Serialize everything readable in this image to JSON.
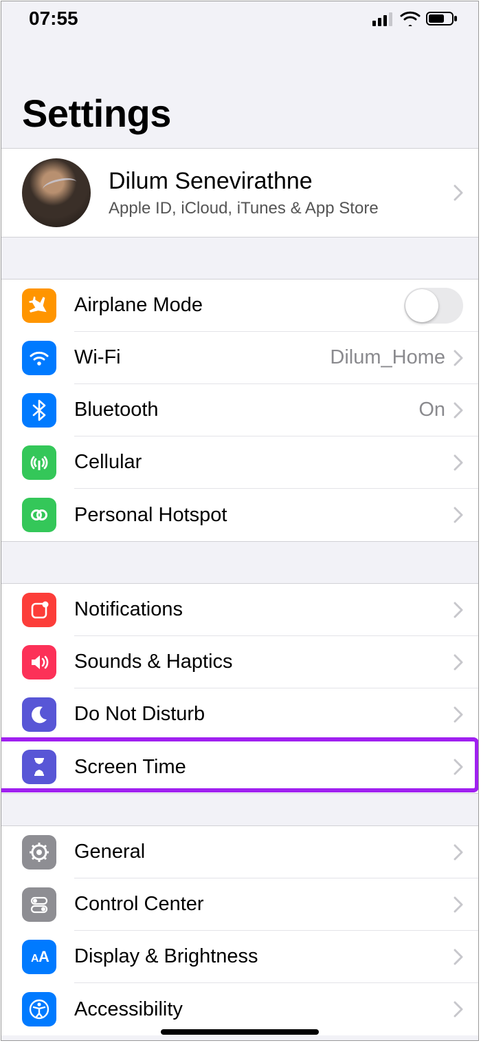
{
  "status": {
    "time": "07:55"
  },
  "page": {
    "title": "Settings"
  },
  "profile": {
    "name": "Dilum Senevirathne",
    "subtitle": "Apple ID, iCloud, iTunes & App Store"
  },
  "rows": {
    "airplane": {
      "label": "Airplane Mode"
    },
    "wifi": {
      "label": "Wi-Fi",
      "detail": "Dilum_Home"
    },
    "bluetooth": {
      "label": "Bluetooth",
      "detail": "On"
    },
    "cellular": {
      "label": "Cellular"
    },
    "hotspot": {
      "label": "Personal Hotspot"
    },
    "notifications": {
      "label": "Notifications"
    },
    "sounds": {
      "label": "Sounds & Haptics"
    },
    "dnd": {
      "label": "Do Not Disturb"
    },
    "screentime": {
      "label": "Screen Time"
    },
    "general": {
      "label": "General"
    },
    "controlcenter": {
      "label": "Control Center"
    },
    "display": {
      "label": "Display & Brightness"
    },
    "accessibility": {
      "label": "Accessibility"
    }
  },
  "colors": {
    "orange": "#ff9500",
    "blue": "#007aff",
    "green": "#34c759",
    "red": "#ff3b30",
    "pink": "#fc3d39",
    "indigo": "#5856d6",
    "gray": "#8e8e93",
    "highlight": "#a020f0"
  }
}
